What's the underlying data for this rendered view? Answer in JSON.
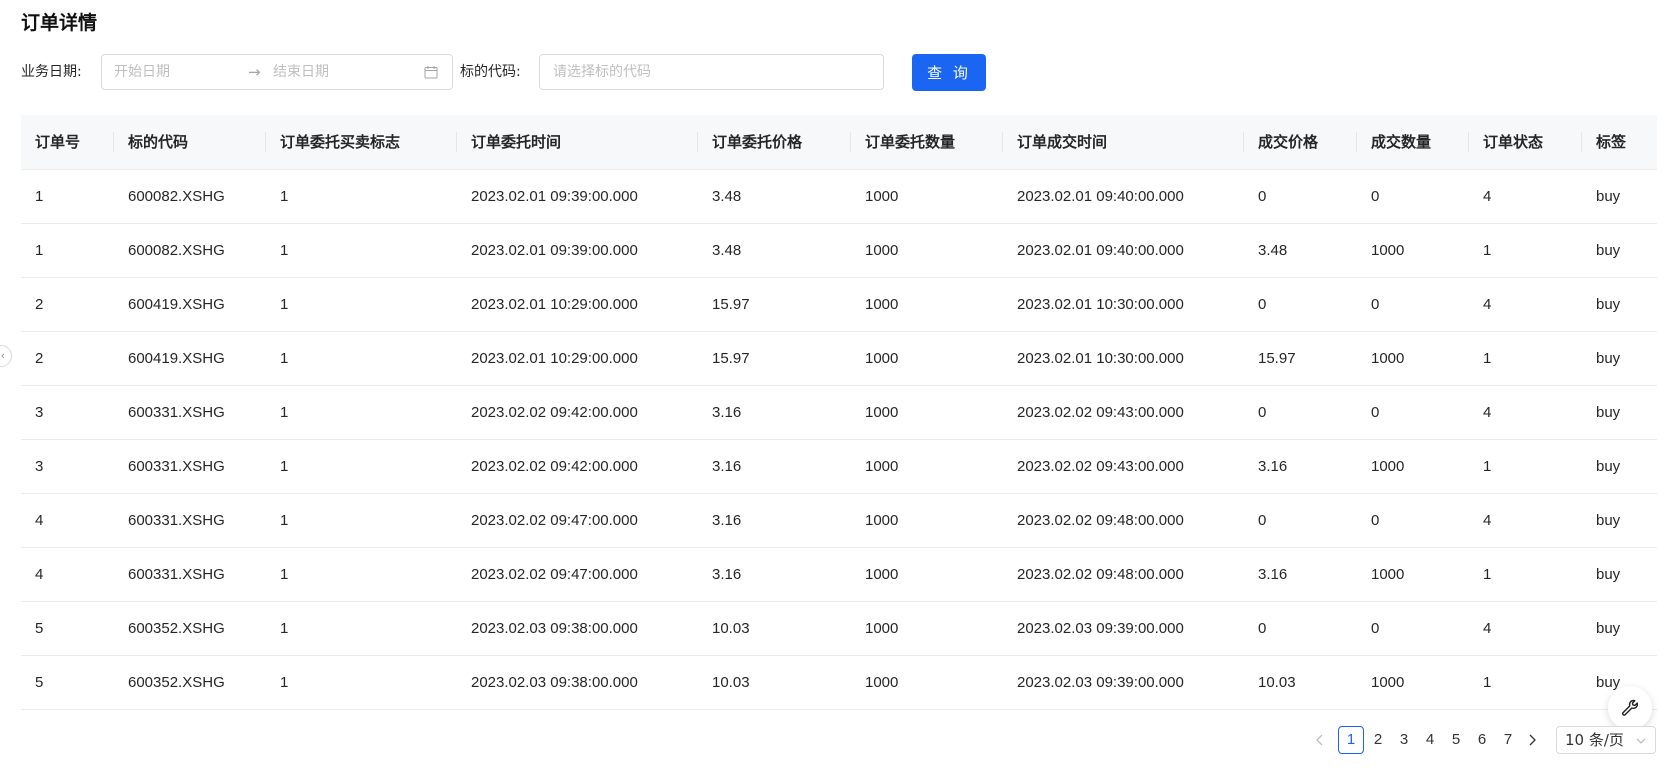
{
  "page": {
    "title": "订单详情"
  },
  "filters": {
    "date_label": "业务日期:",
    "start_placeholder": "开始日期",
    "range_arrow": "→",
    "end_placeholder": "结束日期",
    "symbol_label": "标的代码:",
    "symbol_placeholder": "请选择标的代码",
    "query_button": "查 询"
  },
  "table": {
    "columns": [
      "订单号",
      "标的代码",
      "订单委托买卖标志",
      "订单委托时间",
      "订单委托价格",
      "订单委托数量",
      "订单成交时间",
      "成交价格",
      "成交数量",
      "订单状态",
      "标签"
    ],
    "rows": [
      [
        "1",
        "600082.XSHG",
        "1",
        "2023.02.01 09:39:00.000",
        "3.48",
        "1000",
        "2023.02.01 09:40:00.000",
        "0",
        "0",
        "4",
        "buy"
      ],
      [
        "1",
        "600082.XSHG",
        "1",
        "2023.02.01 09:39:00.000",
        "3.48",
        "1000",
        "2023.02.01 09:40:00.000",
        "3.48",
        "1000",
        "1",
        "buy"
      ],
      [
        "2",
        "600419.XSHG",
        "1",
        "2023.02.01 10:29:00.000",
        "15.97",
        "1000",
        "2023.02.01 10:30:00.000",
        "0",
        "0",
        "4",
        "buy"
      ],
      [
        "2",
        "600419.XSHG",
        "1",
        "2023.02.01 10:29:00.000",
        "15.97",
        "1000",
        "2023.02.01 10:30:00.000",
        "15.97",
        "1000",
        "1",
        "buy"
      ],
      [
        "3",
        "600331.XSHG",
        "1",
        "2023.02.02 09:42:00.000",
        "3.16",
        "1000",
        "2023.02.02 09:43:00.000",
        "0",
        "0",
        "4",
        "buy"
      ],
      [
        "3",
        "600331.XSHG",
        "1",
        "2023.02.02 09:42:00.000",
        "3.16",
        "1000",
        "2023.02.02 09:43:00.000",
        "3.16",
        "1000",
        "1",
        "buy"
      ],
      [
        "4",
        "600331.XSHG",
        "1",
        "2023.02.02 09:47:00.000",
        "3.16",
        "1000",
        "2023.02.02 09:48:00.000",
        "0",
        "0",
        "4",
        "buy"
      ],
      [
        "4",
        "600331.XSHG",
        "1",
        "2023.02.02 09:47:00.000",
        "3.16",
        "1000",
        "2023.02.02 09:48:00.000",
        "3.16",
        "1000",
        "1",
        "buy"
      ],
      [
        "5",
        "600352.XSHG",
        "1",
        "2023.02.03 09:38:00.000",
        "10.03",
        "1000",
        "2023.02.03 09:39:00.000",
        "0",
        "0",
        "4",
        "buy"
      ],
      [
        "5",
        "600352.XSHG",
        "1",
        "2023.02.03 09:38:00.000",
        "10.03",
        "1000",
        "2023.02.03 09:39:00.000",
        "10.03",
        "1000",
        "1",
        "buy"
      ]
    ]
  },
  "pagination": {
    "pages": [
      "1",
      "2",
      "3",
      "4",
      "5",
      "6",
      "7"
    ],
    "current": "1",
    "page_size": "10 条/页"
  },
  "icons": {
    "calendar": "calendar-icon",
    "range_arrow": "arrow-right-icon",
    "collapse": "chevron-left-icon",
    "tool": "wrench-icon",
    "prev": "chevron-left-icon",
    "next": "chevron-right-icon",
    "select": "chevron-down-icon"
  },
  "colors": {
    "primary": "#1a66f2",
    "header_bg": "#f7f8fa",
    "border": "#d9d9d9",
    "placeholder": "#bfbfbf"
  }
}
